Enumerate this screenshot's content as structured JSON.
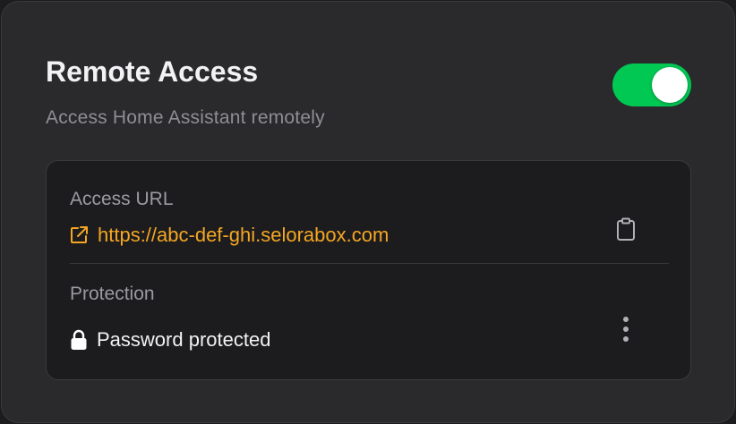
{
  "card": {
    "title": "Remote Access",
    "subtitle": "Access Home Assistant remotely",
    "toggle": {
      "enabled": true,
      "on_color": "#00c853"
    }
  },
  "access_url": {
    "label": "Access URL",
    "url": "https://abc-def-ghi.selorabox.com",
    "link_color": "#f5a623",
    "link_icon": "external-link-icon",
    "action_icon": "clipboard-icon"
  },
  "protection": {
    "label": "Protection",
    "status": "Password protected",
    "status_icon": "lock-icon",
    "action_icon": "more-vertical-icon"
  }
}
